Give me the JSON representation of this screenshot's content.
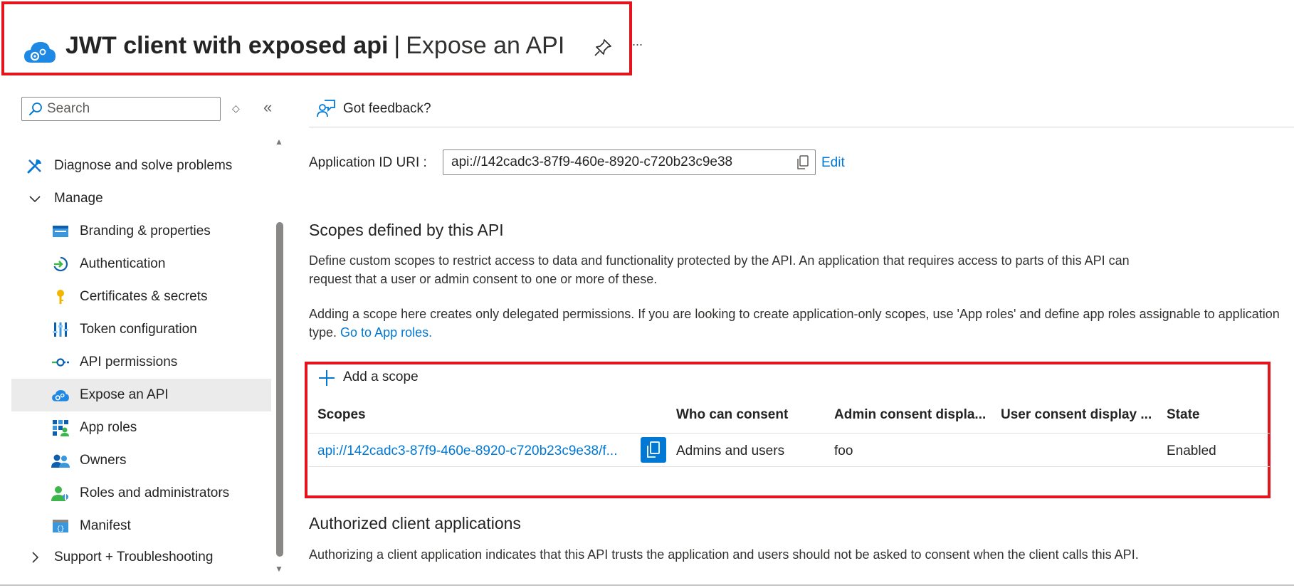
{
  "header": {
    "app_name": "JWT client with exposed api",
    "separator": "|",
    "page_name": "Expose an API",
    "more": "..."
  },
  "sidebar": {
    "search_placeholder": "Search",
    "items": [
      {
        "label": "Diagnose and solve problems",
        "icon": "wrench-icon"
      },
      {
        "label": "Manage",
        "icon": "chevron-down-icon"
      },
      {
        "label": "Branding & properties",
        "icon": "branding-icon"
      },
      {
        "label": "Authentication",
        "icon": "authentication-icon"
      },
      {
        "label": "Certificates & secrets",
        "icon": "key-icon"
      },
      {
        "label": "Token configuration",
        "icon": "token-icon"
      },
      {
        "label": "API permissions",
        "icon": "api-permissions-icon"
      },
      {
        "label": "Expose an API",
        "icon": "cloud-gear-icon"
      },
      {
        "label": "App roles",
        "icon": "app-roles-icon"
      },
      {
        "label": "Owners",
        "icon": "owners-icon"
      },
      {
        "label": "Roles and administrators",
        "icon": "roles-admin-icon"
      },
      {
        "label": "Manifest",
        "icon": "manifest-icon"
      },
      {
        "label": "Support + Troubleshooting",
        "icon": "chevron-right-icon"
      }
    ],
    "active_item": "Expose an API"
  },
  "toolbar": {
    "feedback_label": "Got feedback?"
  },
  "app_id": {
    "label": "Application ID URI :",
    "value": "api://142cadc3-87f9-460e-8920-c720b23c9e38",
    "edit_label": "Edit"
  },
  "scopes_section": {
    "heading": "Scopes defined by this API",
    "description_1": "Define custom scopes to restrict access to data and functionality protected by the API. An application that requires access to parts of this API can request that a user or admin consent to one or more of these.",
    "description_2_prefix": "Adding a scope here creates only delegated permissions. If you are looking to create application-only scopes, use 'App roles' and define app roles assignable to application type.",
    "description_2_link": "Go to App roles.",
    "add_scope_label": "Add a scope",
    "columns": [
      "Scopes",
      "Who can consent",
      "Admin consent displa...",
      "User consent display ...",
      "State"
    ],
    "rows": [
      {
        "scope": "api://142cadc3-87f9-460e-8920-c720b23c9e38/f...",
        "who_can_consent": "Admins and users",
        "admin_consent_display": "foo",
        "user_consent_display": "",
        "state": "Enabled"
      }
    ]
  },
  "authorized_section": {
    "heading": "Authorized client applications",
    "description": "Authorizing a client application indicates that this API trusts the application and users should not be asked to consent when the client calls this API."
  },
  "colors": {
    "accent": "#0078d4",
    "highlight_border": "#e3141b",
    "active_nav_bg": "#ebebeb"
  }
}
